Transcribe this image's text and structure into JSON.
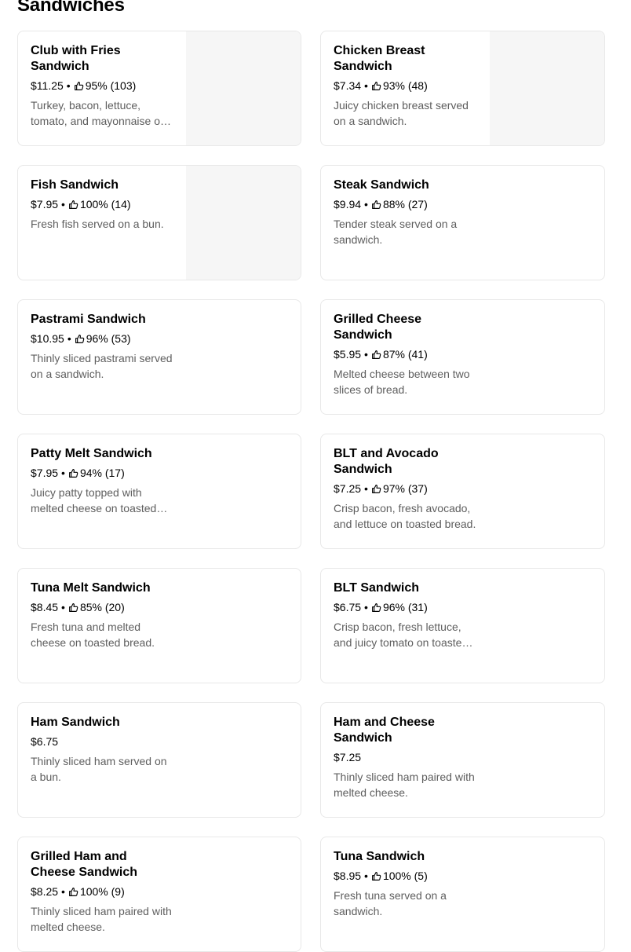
{
  "section": {
    "title": "Sandwiches"
  },
  "items": [
    {
      "name": "Club with Fries Sandwich",
      "price": "$11.25",
      "rating": "95% (103)",
      "description": "Turkey, bacon, lettuce, tomato, and mayonnaise on toasted bread, served with fries.",
      "has_image": true
    },
    {
      "name": "Chicken Breast Sandwich",
      "price": "$7.34",
      "rating": "93% (48)",
      "description": "Juicy chicken breast served on a sandwich.",
      "has_image": true
    },
    {
      "name": "Fish Sandwich",
      "price": "$7.95",
      "rating": "100% (14)",
      "description": "Fresh fish served on a bun.",
      "has_image": true
    },
    {
      "name": "Steak Sandwich",
      "price": "$9.94",
      "rating": "88% (27)",
      "description": "Tender steak served on a sandwich.",
      "has_image": false
    },
    {
      "name": "Pastrami Sandwich",
      "price": "$10.95",
      "rating": "96% (53)",
      "description": "Thinly sliced pastrami served on a sandwich.",
      "has_image": false
    },
    {
      "name": "Grilled Cheese Sandwich",
      "price": "$5.95",
      "rating": "87% (41)",
      "description": "Melted cheese between two slices of bread.",
      "has_image": false
    },
    {
      "name": "Patty Melt Sandwich",
      "price": "$7.95",
      "rating": "94% (17)",
      "description": "Juicy patty topped with melted cheese on toasted bread.",
      "has_image": false
    },
    {
      "name": "BLT and Avocado Sandwich",
      "price": "$7.25",
      "rating": "97% (37)",
      "description": "Crisp bacon, fresh avocado, and lettuce on toasted bread.",
      "has_image": false
    },
    {
      "name": "Tuna Melt Sandwich",
      "price": "$8.45",
      "rating": "85% (20)",
      "description": "Fresh tuna and melted cheese on toasted bread.",
      "has_image": false
    },
    {
      "name": "BLT Sandwich",
      "price": "$6.75",
      "rating": "96% (31)",
      "description": "Crisp bacon, fresh lettuce, and juicy tomato on toasted bread.",
      "has_image": false
    },
    {
      "name": "Ham Sandwich",
      "price": "$6.75",
      "rating": "",
      "description": "Thinly sliced ham served on a bun.",
      "has_image": false
    },
    {
      "name": "Ham and Cheese Sandwich",
      "price": "$7.25",
      "rating": "",
      "description": "Thinly sliced ham paired with melted cheese.",
      "has_image": false
    },
    {
      "name": "Grilled Ham and Cheese Sandwich",
      "price": "$8.25",
      "rating": "100% (9)",
      "description": "Thinly sliced ham paired with melted cheese.",
      "has_image": false
    },
    {
      "name": "Tuna Sandwich",
      "price": "$8.95",
      "rating": "100% (5)",
      "description": "Fresh tuna served on a sandwich.",
      "has_image": false
    }
  ],
  "icons": {
    "rating": "thumbs-up-icon"
  },
  "colors": {
    "description_text": "#5e5e5e",
    "card_border": "#e8e8e8",
    "image_placeholder": "#f6f6f6"
  }
}
